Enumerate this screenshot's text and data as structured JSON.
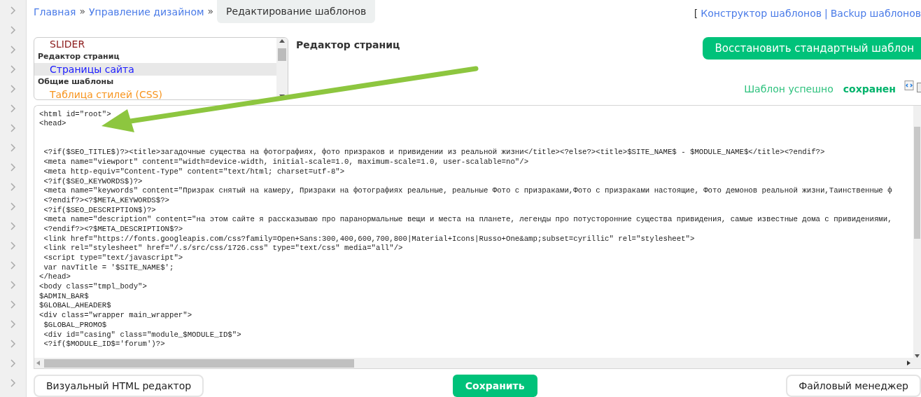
{
  "breadcrumbs": [
    {
      "kind": "link",
      "label": "Главная"
    },
    {
      "kind": "separator",
      "label": "»"
    },
    {
      "kind": "link",
      "label": "Управление дизайном"
    },
    {
      "kind": "separator",
      "label": "»"
    },
    {
      "kind": "current",
      "label": "Редактирование шаблонов"
    }
  ],
  "top_links": [
    {
      "kind": "bracket",
      "label": "["
    },
    {
      "kind": "link",
      "label": "Конструктор шаблонов"
    },
    {
      "kind": "separator",
      "label": "|"
    },
    {
      "kind": "link",
      "label": "Backup шаблонов"
    }
  ],
  "template_list": [
    {
      "kind": "item",
      "label": "SLIDER",
      "color": "#8b1a1a",
      "selected": false
    },
    {
      "kind": "group",
      "label": "Редактор страниц"
    },
    {
      "kind": "item",
      "label": "Страницы сайта",
      "color": "#1a1aff",
      "selected": true
    },
    {
      "kind": "group",
      "label": "Общие шаблоны"
    },
    {
      "kind": "item",
      "label": "Таблица стилей (CSS)",
      "color": "#f7941d",
      "selected": false
    }
  ],
  "editor_title": "Редактор страниц",
  "restore_button": "Восстановить стандартный шаблон",
  "status": {
    "text": "Шаблон успешно",
    "highlight": "сохранен"
  },
  "code_lines": [
    "<html id=\"root\">",
    "<head>",
    {
      "text": " <?if($SEO_TITLE$)?><title>загадочные существа на фотографиях, фото призраков и привидении из реальной жизни</title><?else?><title>$SITE_NAME$ - $MODULE_NAME$</title><?endif?>",
      "blank_lines_before": true
    },
    " <meta name=\"viewport\" content=\"width=device-width, initial-scale=1.0, maximum-scale=1.0, user-scalable=no\"/>",
    " <meta http-equiv=\"Content-Type\" content=\"text/html; charset=utf-8\">",
    " <?if($SEO_KEYWORDS$)?>",
    " <meta name=\"keywords\" content=\"Призрак снятый на камеру, Призраки на фотографиях реальные, реальные Фото с призраками,Фото с призраками настоящие, Фото демонов реальной жизни,Таинственные ф",
    " <?endif?><?$META_KEYWORDS$?>",
    " <?if($SEO_DESCRIPTION$)?>",
    " <meta name=\"description\" content=\"на этом сайте я рассказываю про паранормальные вещи и места на планете, легенды про потусторонние существа привидения, самые известные дома с привидениями,",
    " <?endif?><?$META_DESCRIPTION$?>",
    " <link href=\"https://fonts.googleapis.com/css?family=Open+Sans:300,400,600,700,800|Material+Icons|Russo+One&amp;subset=cyrillic\" rel=\"stylesheet\">",
    " <link rel=\"stylesheet\" href=\"/.s/src/css/1726.css\" type=\"text/css\" media=\"all\"/>",
    " <script type=\"text/javascript\">",
    " var navTitle = '$SITE_NAME$';",
    "</head>",
    "<body class=\"tmpl_body\">",
    "$ADMIN_BAR$",
    "$GLOBAL_AHEADER$",
    "<div class=\"wrapper main_wrapper\">",
    " $GLOBAL_PROMO$",
    " <div id=\"casing\" class=\"module_$MODULE_ID$\">",
    " <?if($MODULE_ID$='forum')?>"
  ],
  "bottom_buttons": [
    {
      "kind": "outline",
      "label": "Визуальный HTML редактор"
    },
    {
      "kind": "primary",
      "label": "Сохранить"
    },
    {
      "kind": "outline",
      "label": "Файловый менеджер"
    }
  ]
}
